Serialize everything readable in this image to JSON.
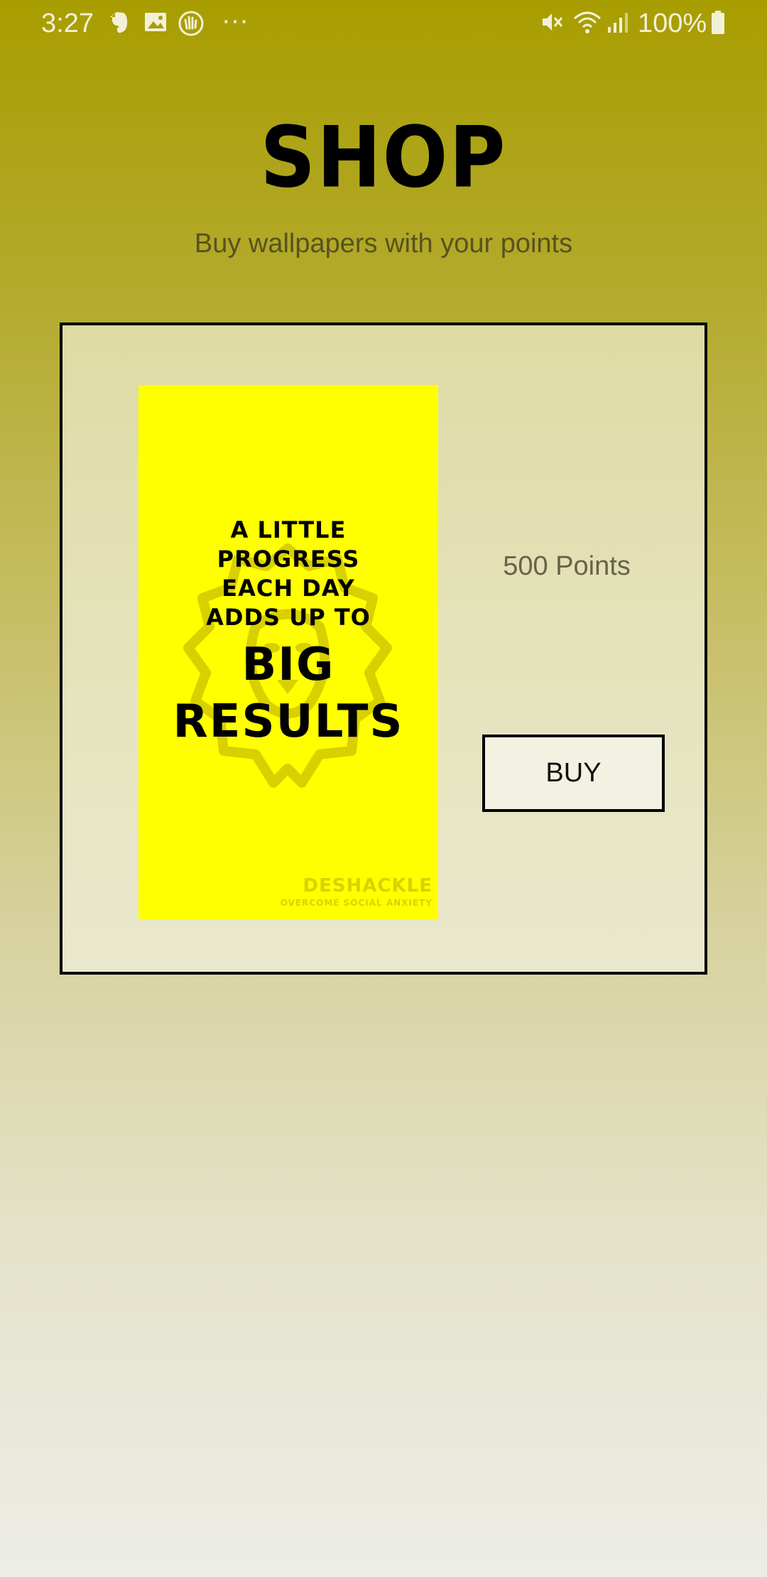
{
  "status_bar": {
    "time": "3:27",
    "battery_percent": "100%",
    "icons": [
      "evernote-icon",
      "gallery-icon",
      "hand-wave-icon",
      "more-dots-icon",
      "mute-icon",
      "wifi-icon",
      "signal-icon",
      "battery-icon"
    ]
  },
  "header": {
    "title": "SHOP",
    "subtitle": "Buy wallpapers with your points"
  },
  "product": {
    "wallpaper": {
      "lines_small": [
        "A LITTLE",
        "PROGRESS",
        "EACH DAY",
        "ADDS UP TO"
      ],
      "lines_big": [
        "BIG",
        "RESULTS"
      ],
      "brand": "DESHACKLE",
      "tagline": "OVERCOME SOCIAL ANXIETY",
      "background_color": "#ffff00"
    },
    "price": "500 Points",
    "buy_label": "BUY"
  }
}
